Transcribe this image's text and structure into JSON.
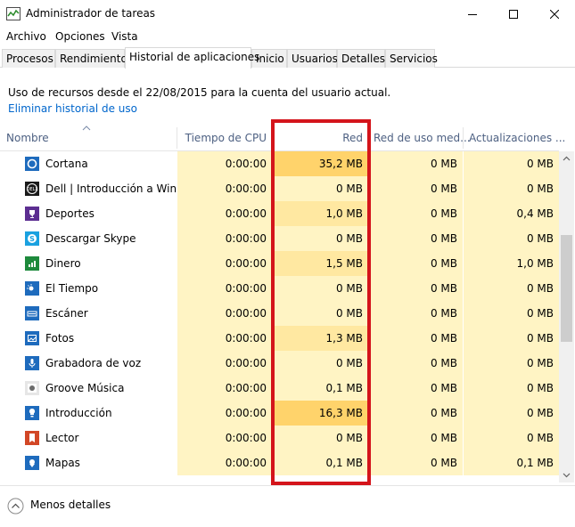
{
  "window": {
    "title": "Administrador de tareas",
    "minimize_icon": "minimize-icon",
    "maximize_icon": "maximize-icon",
    "close_icon": "close-icon"
  },
  "menu": [
    "Archivo",
    "Opciones",
    "Vista"
  ],
  "tabs": [
    {
      "label": "Procesos",
      "active": false
    },
    {
      "label": "Rendimiento",
      "active": false
    },
    {
      "label": "Historial de aplicaciones",
      "active": true
    },
    {
      "label": "Inicio",
      "active": false
    },
    {
      "label": "Usuarios",
      "active": false
    },
    {
      "label": "Detalles",
      "active": false
    },
    {
      "label": "Servicios",
      "active": false
    }
  ],
  "info": {
    "text": "Uso de recursos desde el 22/08/2015 para la cuenta del usuario actual.",
    "link": "Eliminar historial de uso"
  },
  "columns": {
    "name": "Nombre",
    "cpu": "Tiempo de CPU",
    "network": "Red",
    "metered": "Red de uso med...",
    "updates": "Actualizaciones ..."
  },
  "rows": [
    {
      "name": "Cortana",
      "icon": "cortana-icon",
      "cpu": "0:00:00",
      "network": "35,2 MB",
      "metered": "0 MB",
      "updates": "0 MB"
    },
    {
      "name": "Dell | Introducción a Win...",
      "icon": "dell-icon",
      "cpu": "0:00:00",
      "network": "0 MB",
      "metered": "0 MB",
      "updates": "0 MB"
    },
    {
      "name": "Deportes",
      "icon": "trophy-icon",
      "cpu": "0:00:00",
      "network": "1,0 MB",
      "metered": "0 MB",
      "updates": "0,4 MB"
    },
    {
      "name": "Descargar Skype",
      "icon": "skype-icon",
      "cpu": "0:00:00",
      "network": "0 MB",
      "metered": "0 MB",
      "updates": "0 MB"
    },
    {
      "name": "Dinero",
      "icon": "chart-icon",
      "cpu": "0:00:00",
      "network": "1,5 MB",
      "metered": "0 MB",
      "updates": "1,0 MB"
    },
    {
      "name": "El Tiempo",
      "icon": "weather-icon",
      "cpu": "0:00:00",
      "network": "0 MB",
      "metered": "0 MB",
      "updates": "0 MB"
    },
    {
      "name": "Escáner",
      "icon": "scanner-icon",
      "cpu": "0:00:00",
      "network": "0 MB",
      "metered": "0 MB",
      "updates": "0 MB"
    },
    {
      "name": "Fotos",
      "icon": "photos-icon",
      "cpu": "0:00:00",
      "network": "1,3 MB",
      "metered": "0 MB",
      "updates": "0 MB"
    },
    {
      "name": "Grabadora de voz",
      "icon": "microphone-icon",
      "cpu": "0:00:00",
      "network": "0 MB",
      "metered": "0 MB",
      "updates": "0 MB"
    },
    {
      "name": "Groove Música",
      "icon": "groove-icon",
      "cpu": "0:00:00",
      "network": "0,1 MB",
      "metered": "0 MB",
      "updates": "0 MB"
    },
    {
      "name": "Introducción",
      "icon": "lightbulb-icon",
      "cpu": "0:00:00",
      "network": "16,3 MB",
      "metered": "0 MB",
      "updates": "0 MB"
    },
    {
      "name": "Lector",
      "icon": "reader-icon",
      "cpu": "0:00:00",
      "network": "0 MB",
      "metered": "0 MB",
      "updates": "0 MB"
    },
    {
      "name": "Mapas",
      "icon": "maps-icon",
      "cpu": "0:00:00",
      "network": "0,1 MB",
      "metered": "0 MB",
      "updates": "0,1 MB"
    }
  ],
  "colors": {
    "heat_light": "#fff4c4",
    "heat_mid": "#ffe8a1",
    "heat_high": "#ffd36b",
    "tile_blue": "#1e6bbd",
    "highlight_border": "#d4141b",
    "link": "#0066cc"
  },
  "footer": {
    "less_details": "Menos detalles",
    "icon": "chevron-up-circle-icon"
  }
}
